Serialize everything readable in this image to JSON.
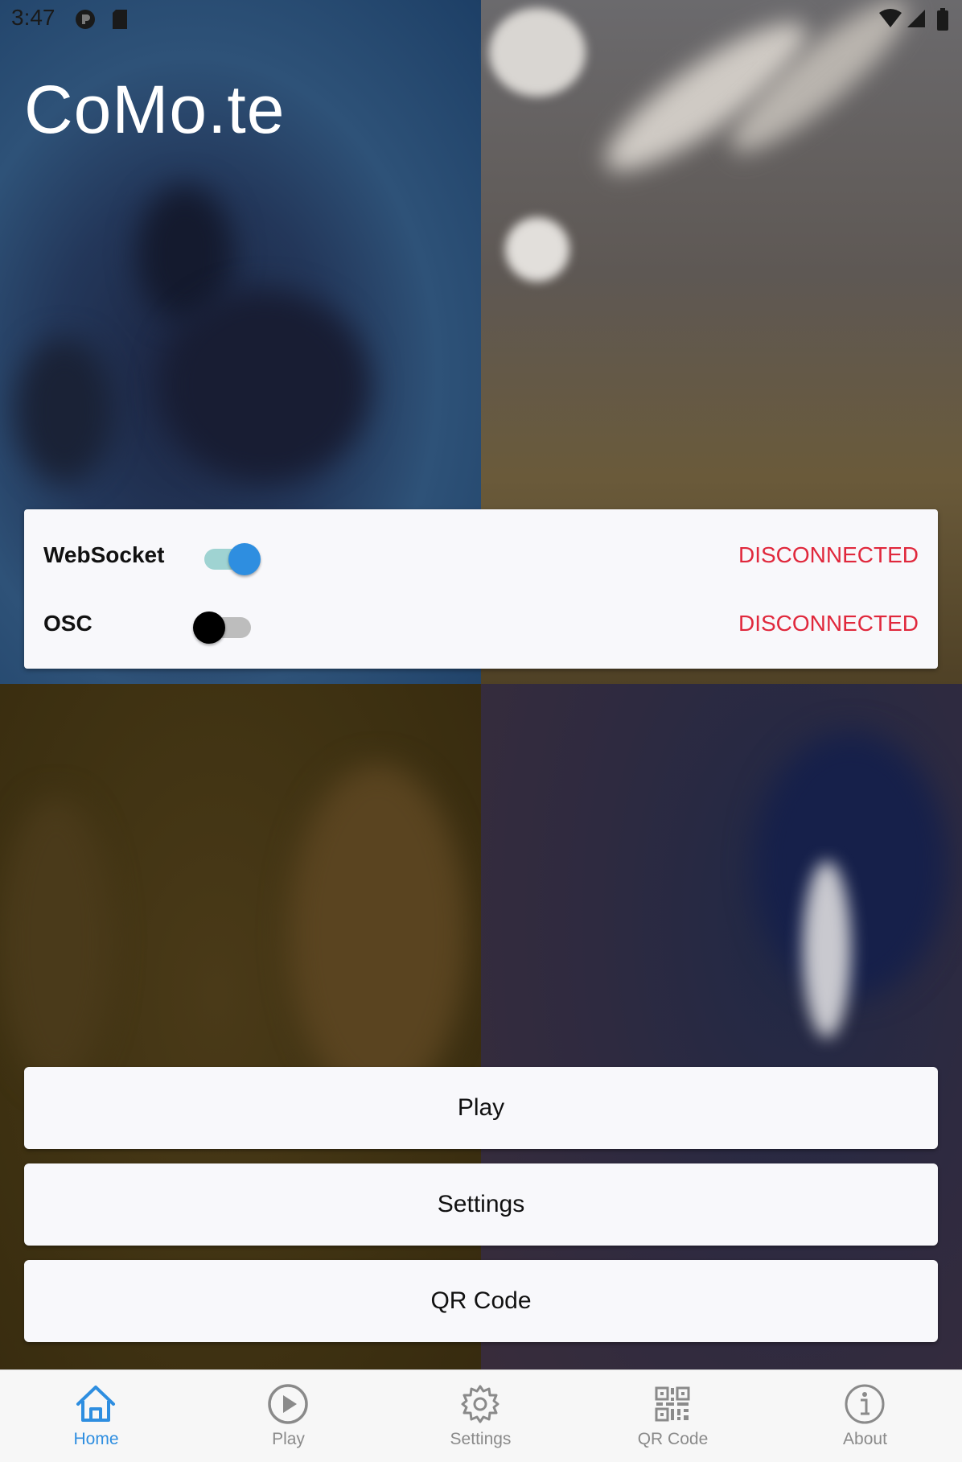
{
  "status_bar": {
    "time": "3:47"
  },
  "app": {
    "title": "CoMo.te"
  },
  "connections": [
    {
      "label": "WebSocket",
      "enabled": true,
      "status": "DISCONNECTED"
    },
    {
      "label": "OSC",
      "enabled": false,
      "status": "DISCONNECTED"
    }
  ],
  "buttons": {
    "play": "Play",
    "settings": "Settings",
    "qr": "QR Code"
  },
  "tabs": [
    {
      "label": "Home",
      "icon": "home-icon",
      "active": true
    },
    {
      "label": "Play",
      "icon": "play-circle-icon",
      "active": false
    },
    {
      "label": "Settings",
      "icon": "gear-icon",
      "active": false
    },
    {
      "label": "QR Code",
      "icon": "qr-code-icon",
      "active": false
    },
    {
      "label": "About",
      "icon": "info-icon",
      "active": false
    }
  ],
  "colors": {
    "accent": "#2e8ee0",
    "error": "#e0283c",
    "card": "#f8f8fb",
    "tab_inactive": "#8a8a8a"
  }
}
